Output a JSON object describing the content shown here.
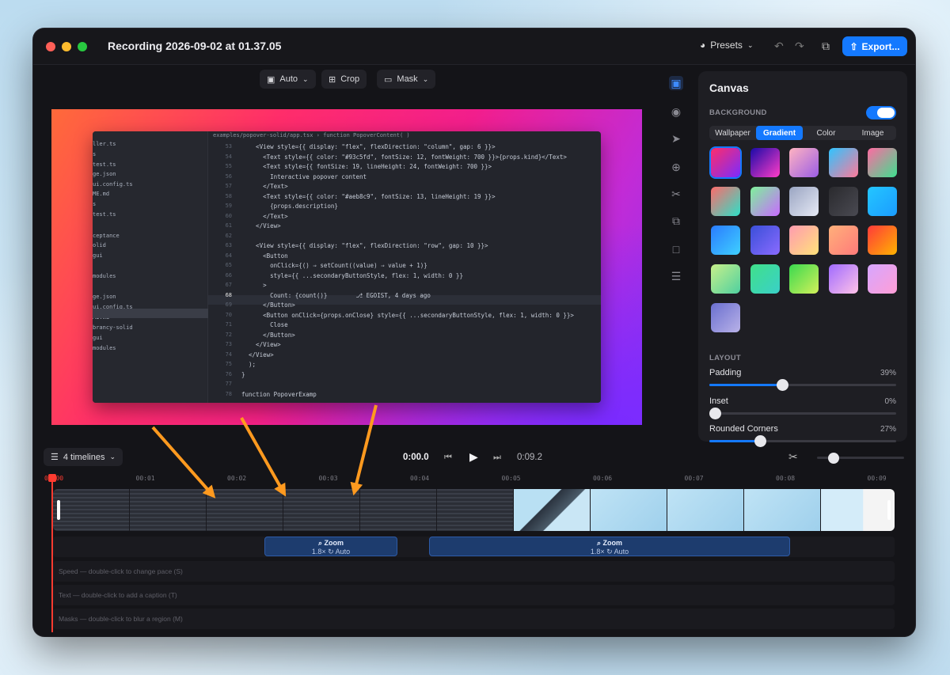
{
  "window": {
    "title": "Recording 2026-09-02 at 01.37.05"
  },
  "toolbar": {
    "presets_label": "Presets",
    "export_label": "Export..."
  },
  "canvas_tools": {
    "auto_label": "Auto",
    "crop_label": "Crop",
    "mask_label": "Mask"
  },
  "editor": {
    "breadcrumb": "examples/popover-solid/app.tsx › function PopoverContent( )",
    "sidebar_files": [
      "ller.ts",
      "s",
      "test.ts",
      "ge.json",
      "ui.config.ts",
      "ME.md",
      "s",
      "test.ts",
      "ceptance",
      "olid",
      "gui",
      "modules",
      "ge.json",
      "ui.config.ts",
      "ME.md",
      "brancy-solid",
      "gui",
      "modules"
    ],
    "line_numbers": [
      "53",
      "54",
      "55",
      "56",
      "57",
      "58",
      "59",
      "60",
      "61",
      "62",
      "63",
      "64",
      "65",
      "66",
      "67",
      "68",
      "69",
      "70",
      "71",
      "72",
      "73",
      "74",
      "75",
      "76",
      "77",
      "78"
    ],
    "code_lines": [
      "    <View style={{ display: \"flex\", flexDirection: \"column\", gap: 6 }}>",
      "      <Text style={{ color: \"#93c5fd\", fontSize: 12, fontWeight: 700 }}>{props.kind}</Text>",
      "      <Text style={{ fontSize: 19, lineHeight: 24, fontWeight: 700 }}>",
      "        Interactive popover content",
      "      </Text>",
      "      <Text style={{ color: \"#aeb8c9\", fontSize: 13, lineHeight: 19 }}>",
      "        {props.description}",
      "      </Text>",
      "    </View>",
      "",
      "    <View style={{ display: \"flex\", flexDirection: \"row\", gap: 10 }}>",
      "      <Button",
      "        onClick={() ⇒ setCount((value) ⇒ value + 1)}",
      "        style={{ ...secondaryButtonStyle, flex: 1, width: 0 }}",
      "      >",
      "        Count: {count()}        ⎇ EGOIST, 4 days ago",
      "      </Button>",
      "      <Button onClick={props.onClose} style={{ ...secondaryButtonStyle, flex: 1, width: 0 }}>",
      "        Close",
      "      </Button>",
      "    </View>",
      "  </View>",
      "  );",
      "}",
      "",
      "function PopoverExamp"
    ]
  },
  "panel": {
    "title": "Canvas",
    "background_label": "BACKGROUND",
    "background_enabled": true,
    "tabs": [
      "Wallpaper",
      "Gradient",
      "Color",
      "Image"
    ],
    "active_tab": "Gradient",
    "layout_label": "LAYOUT",
    "sliders": [
      {
        "label": "Padding",
        "value": "39%",
        "fraction": 0.39
      },
      {
        "label": "Inset",
        "value": "0%",
        "fraction": 0.0
      },
      {
        "label": "Rounded Corners",
        "value": "27%",
        "fraction": 0.27
      }
    ],
    "swatches": [
      [
        "#ff2d6a",
        "#7a2bff"
      ],
      [
        "#1a0aa8",
        "#ff3cc7"
      ],
      [
        "#ffb3c1",
        "#9b5de5"
      ],
      [
        "#2ec4ff",
        "#ff7a9a"
      ],
      [
        "#ff6aa2",
        "#3ee08f"
      ],
      [
        "#ff6b6b",
        "#2de0c8"
      ],
      [
        "#7ef29a",
        "#c86bff"
      ],
      [
        "#9aa5c2",
        "#e6e9f5"
      ],
      [
        "#2a2a2e",
        "#4a4a52"
      ],
      [
        "#24c6ff",
        "#1b9cff"
      ],
      [
        "#2a7bff",
        "#3fd0ff"
      ],
      [
        "#3a4fd8",
        "#8a6bff"
      ],
      [
        "#ff9ab0",
        "#ffe27a"
      ],
      [
        "#ffb07a",
        "#ff7a7a"
      ],
      [
        "#ff3a3a",
        "#ffb300"
      ],
      [
        "#c8f08a",
        "#4fd0a0"
      ],
      [
        "#40e08a",
        "#3ad0c8"
      ],
      [
        "#3ad94f",
        "#d2f05a"
      ],
      [
        "#a06bff",
        "#ffc2e8"
      ],
      [
        "#d6a6ff",
        "#ff9ed6"
      ],
      [
        "#6a6fcf",
        "#b9b2e8"
      ]
    ],
    "selected_swatch": 0
  },
  "timeline": {
    "timelines_label": "4 timelines",
    "current_time": "0:00.0",
    "duration": "0:09.2",
    "ruler_ticks": [
      "00:00",
      "00:01",
      "00:02",
      "00:03",
      "00:04",
      "00:05",
      "00:06",
      "00:07",
      "00:08",
      "00:09"
    ],
    "zoom_clips": [
      {
        "label": "Zoom",
        "detail": "1.8×",
        "mode": "Auto"
      },
      {
        "label": "Zoom",
        "detail": "1.8×",
        "mode": "Auto"
      }
    ],
    "lanes": [
      "Speed — double-click to change pace (S)",
      "Text — double-click to add a caption (T)",
      "Masks — double-click to blur a region (M)"
    ]
  },
  "colors": {
    "accent": "#1479ff",
    "playhead": "#ff3b30",
    "annotation_arrows": "#ff9a1f"
  }
}
